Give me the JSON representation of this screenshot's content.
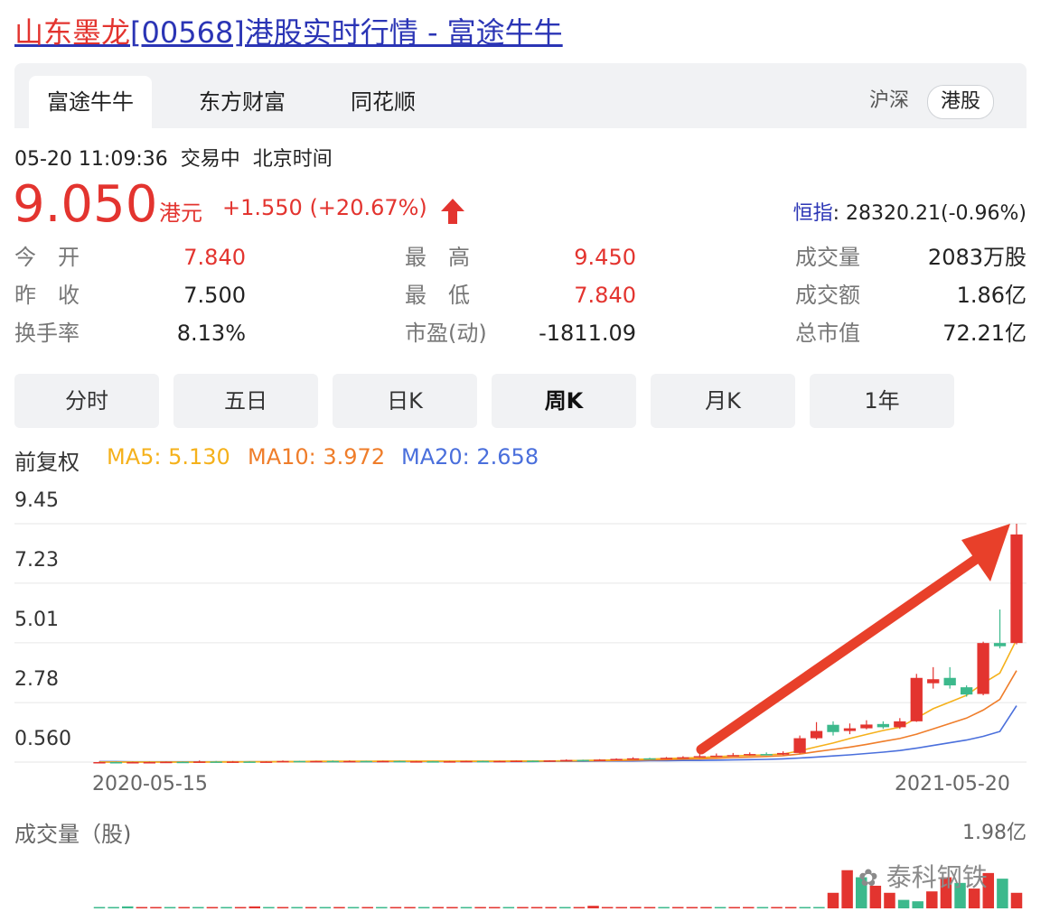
{
  "page": {
    "title_keyword": "山东墨龙",
    "title_rest": "[00568]港股实时行情 - 富途牛牛"
  },
  "tabs": [
    "富途牛牛",
    "东方财富",
    "同花顺"
  ],
  "markets": [
    "沪深",
    "港股"
  ],
  "quote": {
    "datetime": "05-20 11:09:36",
    "status": "交易中",
    "timezone": "北京时间",
    "price": "9.050",
    "currency": "港元",
    "change": "+1.550 (+20.67%)",
    "hsi_label": "恒指",
    "hsi_value": ": 28320.21(-0.96%)"
  },
  "stats": [
    {
      "label": "今　开",
      "value": "7.840",
      "color": "#e3342f"
    },
    {
      "label": "最　高",
      "value": "9.450",
      "color": "#e3342f"
    },
    {
      "label": "成交量",
      "value": "2083万股",
      "color": "#222222"
    },
    {
      "label": "昨　收",
      "value": "7.500",
      "color": "#222222"
    },
    {
      "label": "最　低",
      "value": "7.840",
      "color": "#e3342f"
    },
    {
      "label": "成交额",
      "value": "1.86亿",
      "color": "#222222"
    },
    {
      "label": "换手率",
      "value": "8.13%",
      "color": "#222222"
    },
    {
      "label": "市盈(动)",
      "value": "-1811.09",
      "color": "#222222"
    },
    {
      "label": "总市值",
      "value": "72.21亿",
      "color": "#222222"
    }
  ],
  "periods": [
    "分时",
    "五日",
    "日K",
    "周K",
    "月K",
    "1年"
  ],
  "active_period": "周K",
  "indicators": {
    "adjust": "前复权",
    "ma5": "MA5: 5.130",
    "ma10": "MA10: 3.972",
    "ma20": "MA20: 2.658",
    "ma5_color": "#f5b11b",
    "ma10_color": "#ef7d2a",
    "ma20_color": "#4a6fdc"
  },
  "volume": {
    "title": "成交量（股)",
    "max": "1.98亿"
  },
  "watermark": "泰科钢铁",
  "colors": {
    "up": "#e3342f",
    "down": "#3cb98c",
    "accent": "#2b35b5"
  },
  "chart_data": {
    "type": "candlestick",
    "y_ticks": [
      "9.45",
      "7.23",
      "5.01",
      "2.78",
      "0.560"
    ],
    "ylim": [
      0.56,
      9.45
    ],
    "x_labels": [
      "2020-05-15",
      "2021-05-20"
    ],
    "candles": [
      {
        "o": 0.56,
        "c": 0.56,
        "h": 0.58,
        "l": 0.55
      },
      {
        "o": 0.56,
        "c": 0.55,
        "h": 0.57,
        "l": 0.54
      },
      {
        "o": 0.55,
        "c": 0.56,
        "h": 0.57,
        "l": 0.54
      },
      {
        "o": 0.56,
        "c": 0.56,
        "h": 0.57,
        "l": 0.55
      },
      {
        "o": 0.56,
        "c": 0.57,
        "h": 0.58,
        "l": 0.55
      },
      {
        "o": 0.57,
        "c": 0.56,
        "h": 0.58,
        "l": 0.55
      },
      {
        "o": 0.56,
        "c": 0.58,
        "h": 0.62,
        "l": 0.55
      },
      {
        "o": 0.58,
        "c": 0.57,
        "h": 0.6,
        "l": 0.56
      },
      {
        "o": 0.57,
        "c": 0.58,
        "h": 0.6,
        "l": 0.56
      },
      {
        "o": 0.58,
        "c": 0.57,
        "h": 0.59,
        "l": 0.56
      },
      {
        "o": 0.57,
        "c": 0.58,
        "h": 0.59,
        "l": 0.56
      },
      {
        "o": 0.58,
        "c": 0.6,
        "h": 0.62,
        "l": 0.57
      },
      {
        "o": 0.6,
        "c": 0.59,
        "h": 0.61,
        "l": 0.58
      },
      {
        "o": 0.59,
        "c": 0.6,
        "h": 0.61,
        "l": 0.58
      },
      {
        "o": 0.6,
        "c": 0.58,
        "h": 0.62,
        "l": 0.57
      },
      {
        "o": 0.58,
        "c": 0.6,
        "h": 0.62,
        "l": 0.57
      },
      {
        "o": 0.6,
        "c": 0.59,
        "h": 0.61,
        "l": 0.58
      },
      {
        "o": 0.59,
        "c": 0.6,
        "h": 0.61,
        "l": 0.58
      },
      {
        "o": 0.6,
        "c": 0.58,
        "h": 0.61,
        "l": 0.57
      },
      {
        "o": 0.58,
        "c": 0.59,
        "h": 0.6,
        "l": 0.57
      },
      {
        "o": 0.59,
        "c": 0.58,
        "h": 0.6,
        "l": 0.57
      },
      {
        "o": 0.58,
        "c": 0.59,
        "h": 0.6,
        "l": 0.57
      },
      {
        "o": 0.59,
        "c": 0.6,
        "h": 0.61,
        "l": 0.58
      },
      {
        "o": 0.6,
        "c": 0.59,
        "h": 0.61,
        "l": 0.58
      },
      {
        "o": 0.59,
        "c": 0.6,
        "h": 0.61,
        "l": 0.58
      },
      {
        "o": 0.6,
        "c": 0.61,
        "h": 0.62,
        "l": 0.59
      },
      {
        "o": 0.61,
        "c": 0.6,
        "h": 0.62,
        "l": 0.59
      },
      {
        "o": 0.6,
        "c": 0.62,
        "h": 0.63,
        "l": 0.59
      },
      {
        "o": 0.62,
        "c": 0.64,
        "h": 0.66,
        "l": 0.61
      },
      {
        "o": 0.64,
        "c": 0.63,
        "h": 0.65,
        "l": 0.62
      },
      {
        "o": 0.63,
        "c": 0.65,
        "h": 0.67,
        "l": 0.62
      },
      {
        "o": 0.65,
        "c": 0.68,
        "h": 0.7,
        "l": 0.64
      },
      {
        "o": 0.68,
        "c": 0.7,
        "h": 0.74,
        "l": 0.67
      },
      {
        "o": 0.7,
        "c": 0.69,
        "h": 0.72,
        "l": 0.68
      },
      {
        "o": 0.69,
        "c": 0.72,
        "h": 0.75,
        "l": 0.68
      },
      {
        "o": 0.72,
        "c": 0.74,
        "h": 0.78,
        "l": 0.7
      },
      {
        "o": 0.74,
        "c": 0.78,
        "h": 0.86,
        "l": 0.72
      },
      {
        "o": 0.78,
        "c": 0.8,
        "h": 0.88,
        "l": 0.76
      },
      {
        "o": 0.8,
        "c": 0.82,
        "h": 0.9,
        "l": 0.78
      },
      {
        "o": 0.82,
        "c": 0.86,
        "h": 0.92,
        "l": 0.8
      },
      {
        "o": 0.86,
        "c": 0.84,
        "h": 0.92,
        "l": 0.82
      },
      {
        "o": 0.84,
        "c": 0.9,
        "h": 0.96,
        "l": 0.82
      },
      {
        "o": 0.9,
        "c": 1.45,
        "h": 1.55,
        "l": 0.88
      },
      {
        "o": 1.45,
        "c": 1.72,
        "h": 2.05,
        "l": 1.4
      },
      {
        "o": 1.95,
        "c": 1.68,
        "h": 2.08,
        "l": 1.55
      },
      {
        "o": 1.72,
        "c": 1.82,
        "h": 2.0,
        "l": 1.6
      },
      {
        "o": 1.82,
        "c": 1.96,
        "h": 2.12,
        "l": 1.78
      },
      {
        "o": 1.98,
        "c": 1.86,
        "h": 2.08,
        "l": 1.8
      },
      {
        "o": 1.86,
        "c": 2.08,
        "h": 2.2,
        "l": 1.8
      },
      {
        "o": 2.08,
        "c": 3.7,
        "h": 3.85,
        "l": 2.06
      },
      {
        "o": 3.5,
        "c": 3.65,
        "h": 4.1,
        "l": 3.3
      },
      {
        "o": 3.7,
        "c": 3.42,
        "h": 4.1,
        "l": 3.3
      },
      {
        "o": 3.35,
        "c": 3.08,
        "h": 3.42,
        "l": 3.0
      },
      {
        "o": 3.1,
        "c": 5.0,
        "h": 5.05,
        "l": 3.05
      },
      {
        "o": 5.0,
        "c": 4.88,
        "h": 6.25,
        "l": 4.8
      },
      {
        "o": 5.0,
        "c": 9.05,
        "h": 9.45,
        "l": 4.95
      }
    ],
    "ma5": [
      0.56,
      0.56,
      0.56,
      0.56,
      0.56,
      0.56,
      0.56,
      0.57,
      0.57,
      0.57,
      0.57,
      0.58,
      0.58,
      0.59,
      0.59,
      0.59,
      0.59,
      0.59,
      0.59,
      0.59,
      0.59,
      0.59,
      0.59,
      0.59,
      0.59,
      0.6,
      0.6,
      0.6,
      0.61,
      0.62,
      0.63,
      0.64,
      0.66,
      0.67,
      0.69,
      0.71,
      0.73,
      0.76,
      0.79,
      0.81,
      0.83,
      0.86,
      0.98,
      1.13,
      1.27,
      1.44,
      1.59,
      1.74,
      1.86,
      2.2,
      2.55,
      2.8,
      3.05,
      3.5,
      3.88,
      5.13
    ],
    "ma10": [
      0.56,
      0.56,
      0.56,
      0.56,
      0.56,
      0.56,
      0.56,
      0.56,
      0.56,
      0.57,
      0.57,
      0.57,
      0.57,
      0.58,
      0.58,
      0.58,
      0.58,
      0.59,
      0.59,
      0.59,
      0.59,
      0.59,
      0.59,
      0.59,
      0.59,
      0.59,
      0.6,
      0.6,
      0.6,
      0.61,
      0.61,
      0.62,
      0.63,
      0.64,
      0.65,
      0.67,
      0.68,
      0.7,
      0.73,
      0.75,
      0.77,
      0.8,
      0.86,
      0.95,
      1.03,
      1.12,
      1.22,
      1.33,
      1.44,
      1.6,
      1.8,
      2.0,
      2.2,
      2.5,
      2.9,
      3.97
    ],
    "ma20": [
      0.58,
      0.58,
      0.57,
      0.57,
      0.57,
      0.57,
      0.57,
      0.57,
      0.57,
      0.57,
      0.57,
      0.57,
      0.57,
      0.57,
      0.57,
      0.57,
      0.57,
      0.58,
      0.58,
      0.58,
      0.58,
      0.58,
      0.58,
      0.58,
      0.58,
      0.58,
      0.58,
      0.59,
      0.59,
      0.59,
      0.6,
      0.6,
      0.6,
      0.61,
      0.61,
      0.62,
      0.62,
      0.63,
      0.64,
      0.65,
      0.66,
      0.68,
      0.71,
      0.75,
      0.79,
      0.83,
      0.88,
      0.93,
      0.99,
      1.08,
      1.18,
      1.28,
      1.38,
      1.52,
      1.7,
      2.66
    ],
    "volumes": [
      0.02,
      0.02,
      0.07,
      0.03,
      0.02,
      0.02,
      0.03,
      0.02,
      0.02,
      0.02,
      0.02,
      0.07,
      0.03,
      0.02,
      0.02,
      0.03,
      0.02,
      0.02,
      0.02,
      0.02,
      0.02,
      0.02,
      0.02,
      0.02,
      0.02,
      0.02,
      0.02,
      0.02,
      0.02,
      0.02,
      0.02,
      0.02,
      0.02,
      0.02,
      0.02,
      0.09,
      0.02,
      0.03,
      0.05,
      0.03,
      0.03,
      0.02,
      0.02,
      0.02,
      0.02,
      0.02,
      0.02,
      0.02,
      0.02,
      0.02,
      0.02,
      0.02,
      0.55,
      1.35,
      1.1,
      0.8,
      0.55,
      0.3,
      0.25,
      0.6,
      1.1,
      0.9,
      0.7,
      1.25,
      1.05,
      0.55
    ],
    "volume_up": [
      false,
      false,
      false,
      true,
      true,
      false,
      true,
      false,
      true,
      false,
      true,
      true,
      false,
      true,
      false,
      true,
      false,
      true,
      false,
      true,
      false,
      true,
      true,
      false,
      true,
      true,
      false,
      true,
      true,
      false,
      true,
      true,
      true,
      false,
      true,
      true,
      true,
      true,
      true,
      true,
      false,
      true,
      true,
      true,
      false,
      true,
      true,
      false,
      true,
      true,
      false,
      false,
      true,
      true,
      false,
      true,
      true,
      false,
      false,
      true,
      true,
      false,
      true,
      true,
      false,
      true
    ]
  }
}
